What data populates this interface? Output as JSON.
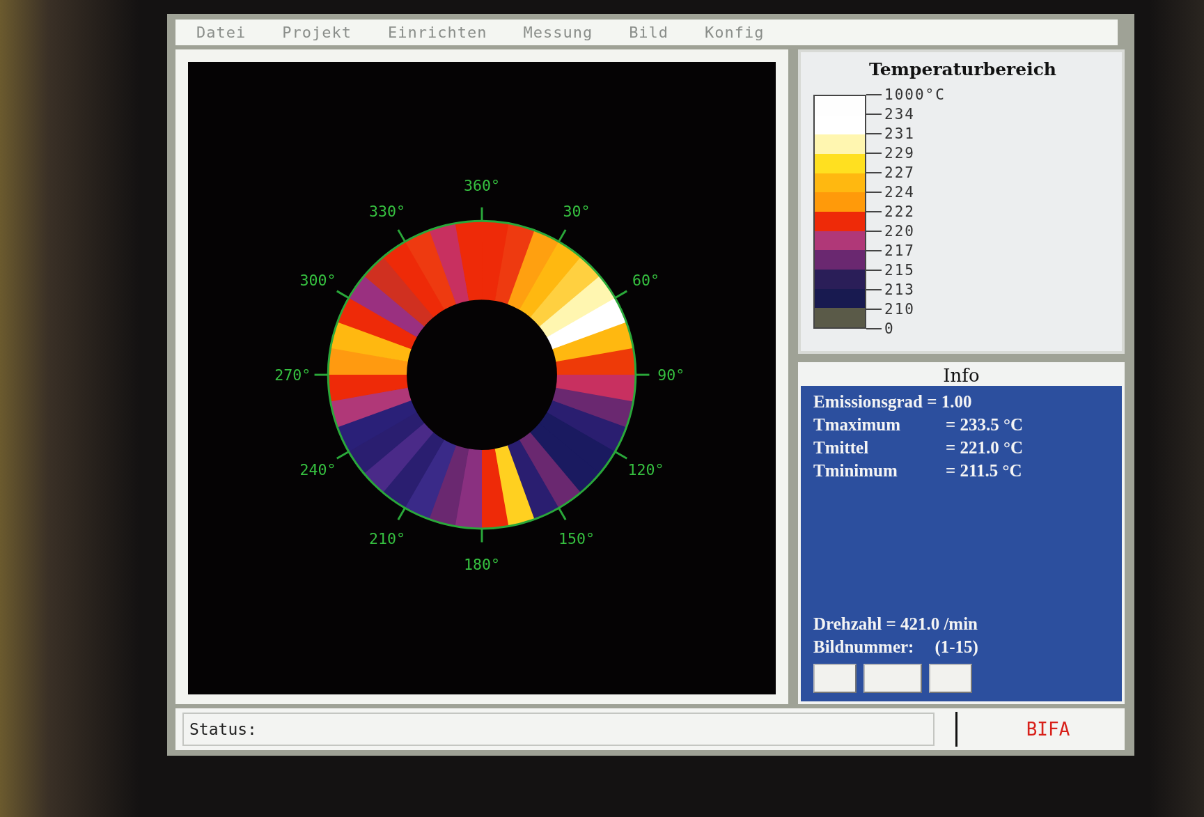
{
  "menu": [
    {
      "label": "Datei"
    },
    {
      "label": "Projekt"
    },
    {
      "label": "Einrichten"
    },
    {
      "label": "Messung"
    },
    {
      "label": "Bild"
    },
    {
      "label": "Konfig"
    }
  ],
  "plot": {
    "angle_labels": [
      "360°",
      "30°",
      "60°",
      "90°",
      "120°",
      "150°",
      "180°",
      "210°",
      "240°",
      "270°",
      "300°",
      "330°"
    ]
  },
  "legend": {
    "title": "Temperaturbereich",
    "ticks": [
      "1000°C",
      "234",
      "231",
      "229",
      "227",
      "224",
      "222",
      "220",
      "217",
      "215",
      "213",
      "210",
      "0"
    ],
    "bands": [
      {
        "color": "#fefefe"
      },
      {
        "color": "#ffffff"
      },
      {
        "color": "#fff6b0"
      },
      {
        "color": "#ffe020"
      },
      {
        "color": "#ffb810"
      },
      {
        "color": "#ff9a0a"
      },
      {
        "color": "#ee2a08"
      },
      {
        "color": "#b03878"
      },
      {
        "color": "#6a2870"
      },
      {
        "color": "#2a1e58"
      },
      {
        "color": "#181a50"
      },
      {
        "color": "#5a5a48"
      }
    ]
  },
  "info": {
    "title": "Info",
    "emission": "Emissionsgrad = 1.00",
    "rows": [
      {
        "label": "Tmaximum",
        "value": "= 233.5 °C"
      },
      {
        "label": "Tmittel",
        "value": "= 221.0 °C"
      },
      {
        "label": "Tminimum",
        "value": "= 211.5 °C"
      }
    ],
    "speed": "Drehzahl =  421.0 /min",
    "image_number_label": "Bildnummer:",
    "image_number_range": "(1-15)",
    "buttons": [
      {
        "kind": "narrow"
      },
      {
        "kind": "wide"
      },
      {
        "kind": "narrow"
      }
    ]
  },
  "status_bar": {
    "label": "Status:",
    "brand": "BIFA"
  }
}
